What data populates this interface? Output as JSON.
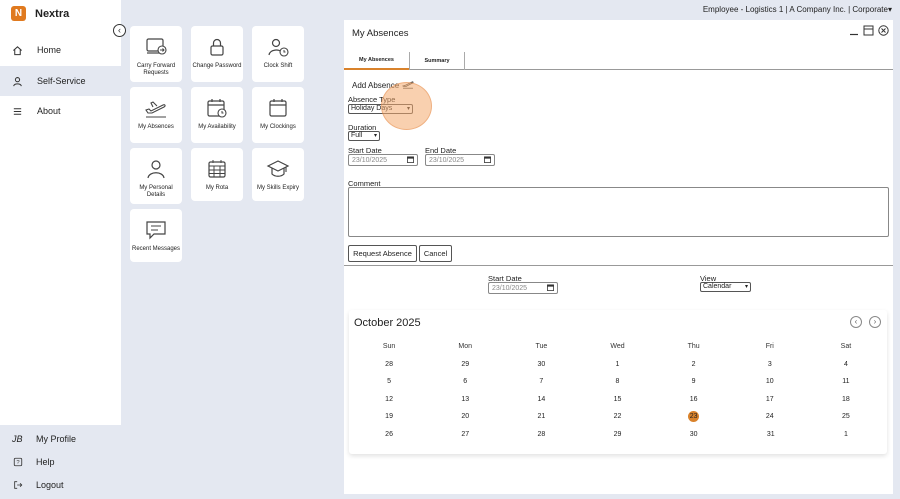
{
  "brand": {
    "name": "Nextra",
    "logo_letter": "N",
    "accent": "#e07a1f"
  },
  "topbar": {
    "context": "Employee - Logistics 1 | A Company Inc. | Corporate",
    "caret": "▾"
  },
  "sidebar": {
    "items": [
      {
        "label": "Home",
        "icon": "home-icon"
      },
      {
        "label": "Self-Service",
        "icon": "person-icon"
      },
      {
        "label": "About",
        "icon": "menu-icon"
      }
    ],
    "bottom": [
      {
        "label": "My Profile",
        "initials": "JB"
      },
      {
        "label": "Help",
        "icon": "help-icon"
      },
      {
        "label": "Logout",
        "icon": "logout-icon"
      }
    ]
  },
  "tiles": [
    {
      "label": "Carry Forward Requests",
      "icon": "carry-forward-icon"
    },
    {
      "label": "Change Password",
      "icon": "lock-icon"
    },
    {
      "label": "Clock Shift",
      "icon": "clock-shift-icon"
    },
    {
      "label": "My Absences",
      "icon": "plane-icon"
    },
    {
      "label": "My Availability",
      "icon": "calendar-clock-icon"
    },
    {
      "label": "My Clockings",
      "icon": "calendar-icon"
    },
    {
      "label": "My Personal Details",
      "icon": "user-icon"
    },
    {
      "label": "My Rota",
      "icon": "grid-calendar-icon"
    },
    {
      "label": "My Skills Expiry",
      "icon": "graduation-icon"
    },
    {
      "label": "Recent Messages",
      "icon": "message-icon"
    }
  ],
  "panel": {
    "title": "My Absences",
    "tabs": [
      "My Absences",
      "Summary"
    ],
    "add_absence": "Add Absence",
    "absence_type_label": "Absence Type",
    "absence_type_value": "Holiday Days",
    "duration_label": "Duration",
    "duration_value": "Full",
    "start_date_label": "Start Date",
    "start_date_value": "23/10/2025",
    "end_date_label": "End Date",
    "end_date_value": "23/10/2025",
    "comment_label": "Comment",
    "comment_value": "",
    "request_button": "Request Absence",
    "cancel_button": "Cancel",
    "filter_start_label": "Start Date",
    "filter_start_value": "23/10/2025",
    "view_label": "View",
    "view_value": "Calendar"
  },
  "calendar": {
    "month": "October 2025",
    "weekdays": [
      "Sun",
      "Mon",
      "Tue",
      "Wed",
      "Thu",
      "Fri",
      "Sat"
    ],
    "weeks": [
      [
        "28",
        "29",
        "30",
        "1",
        "2",
        "3",
        "4"
      ],
      [
        "5",
        "6",
        "7",
        "8",
        "9",
        "10",
        "11"
      ],
      [
        "12",
        "13",
        "14",
        "15",
        "16",
        "17",
        "18"
      ],
      [
        "19",
        "20",
        "21",
        "22",
        "23",
        "24",
        "25"
      ],
      [
        "26",
        "27",
        "28",
        "29",
        "30",
        "31",
        "1"
      ]
    ],
    "muted": [
      [
        0,
        0
      ],
      [
        0,
        1
      ],
      [
        0,
        2
      ],
      [
        4,
        6
      ]
    ],
    "today": [
      3,
      4
    ],
    "dot": [
      4,
      5
    ],
    "today_color": "#d9822b"
  }
}
